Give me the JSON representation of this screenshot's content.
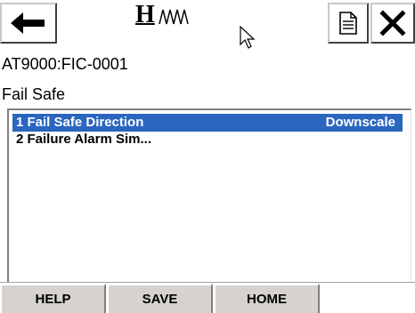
{
  "header": {
    "back_icon": "left-arrow-icon",
    "logo_letter": "H",
    "logo_icon": "hart-wave-icon",
    "document_icon": "document-icon",
    "close_icon": "close-x-icon",
    "cursor_icon": "mouse-pointer-icon"
  },
  "device": {
    "tag": "AT9000:FIC-0001"
  },
  "screen": {
    "title": "Fail Safe"
  },
  "menu": {
    "items": [
      {
        "label": "1 Fail Safe Direction",
        "value": "Downscale",
        "selected": true
      },
      {
        "label": "2 Failure Alarm Sim...",
        "value": "",
        "selected": false
      }
    ]
  },
  "softkeys": {
    "help": "HELP",
    "save": "SAVE",
    "home": "HOME"
  },
  "colors": {
    "selection": "#2a65c0",
    "softkey_bg": "#d6d3ce"
  }
}
